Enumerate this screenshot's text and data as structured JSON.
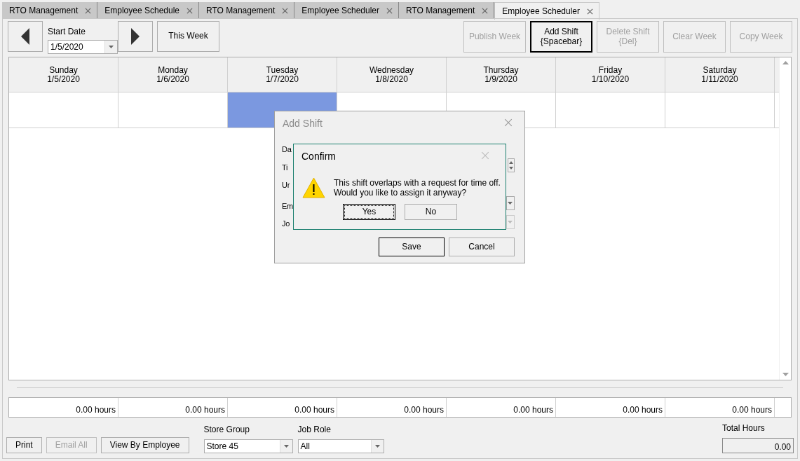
{
  "tabs": [
    {
      "label": "RTO Management",
      "selected": false
    },
    {
      "label": "Employee Schedule",
      "selected": false
    },
    {
      "label": "RTO Management",
      "selected": false
    },
    {
      "label": "Employee Scheduler",
      "selected": false
    },
    {
      "label": "RTO Management",
      "selected": false
    },
    {
      "label": "Employee Scheduler",
      "selected": true
    }
  ],
  "toolbar": {
    "start_date_label": "Start Date",
    "start_date": "1/5/2020",
    "this_week": "This Week",
    "buttons": [
      {
        "label": "Publish Week",
        "disabled": true
      },
      {
        "label": "Add Shift",
        "shortcut": "{Spacebar}",
        "disabled": false
      },
      {
        "label": "Delete Shift",
        "shortcut": "{Del}",
        "disabled": true
      },
      {
        "label": "Clear Week",
        "disabled": true
      },
      {
        "label": "Copy Week",
        "disabled": true
      }
    ]
  },
  "days": [
    {
      "name": "Sunday",
      "date": "1/5/2020",
      "selected": false,
      "hours": "0.00 hours"
    },
    {
      "name": "Monday",
      "date": "1/6/2020",
      "selected": false,
      "hours": "0.00 hours"
    },
    {
      "name": "Tuesday",
      "date": "1/7/2020",
      "selected": true,
      "hours": "0.00 hours"
    },
    {
      "name": "Wednesday",
      "date": "1/8/2020",
      "selected": false,
      "hours": "0.00 hours"
    },
    {
      "name": "Thursday",
      "date": "1/9/2020",
      "selected": false,
      "hours": "0.00 hours"
    },
    {
      "name": "Friday",
      "date": "1/10/2020",
      "selected": false,
      "hours": "0.00 hours"
    },
    {
      "name": "Saturday",
      "date": "1/11/2020",
      "selected": false,
      "hours": "0.00 hours"
    }
  ],
  "bottom": {
    "buttons": [
      {
        "label": "Print",
        "disabled": false
      },
      {
        "label": "Email All",
        "disabled": true
      },
      {
        "label": "View By Employee",
        "disabled": false
      }
    ],
    "store_group": {
      "label": "Store Group",
      "value": "Store 45"
    },
    "job_role": {
      "label": "Job Role",
      "value": "All"
    },
    "total_hours": {
      "label": "Total Hours",
      "value": "0.00"
    }
  },
  "add_shift_dialog": {
    "title": "Add Shift",
    "labels": [
      "Da",
      "Ti",
      "Ur",
      "Em",
      "Jo"
    ],
    "buttons": [
      "Save",
      "Cancel"
    ]
  },
  "confirm_dialog": {
    "title": "Confirm",
    "message": [
      "This shift overlaps with a request for time off.",
      "Would you like to assign it anyway?"
    ],
    "buttons": [
      {
        "label": "Yes",
        "focused": true
      },
      {
        "label": "No",
        "focused": false
      }
    ]
  }
}
